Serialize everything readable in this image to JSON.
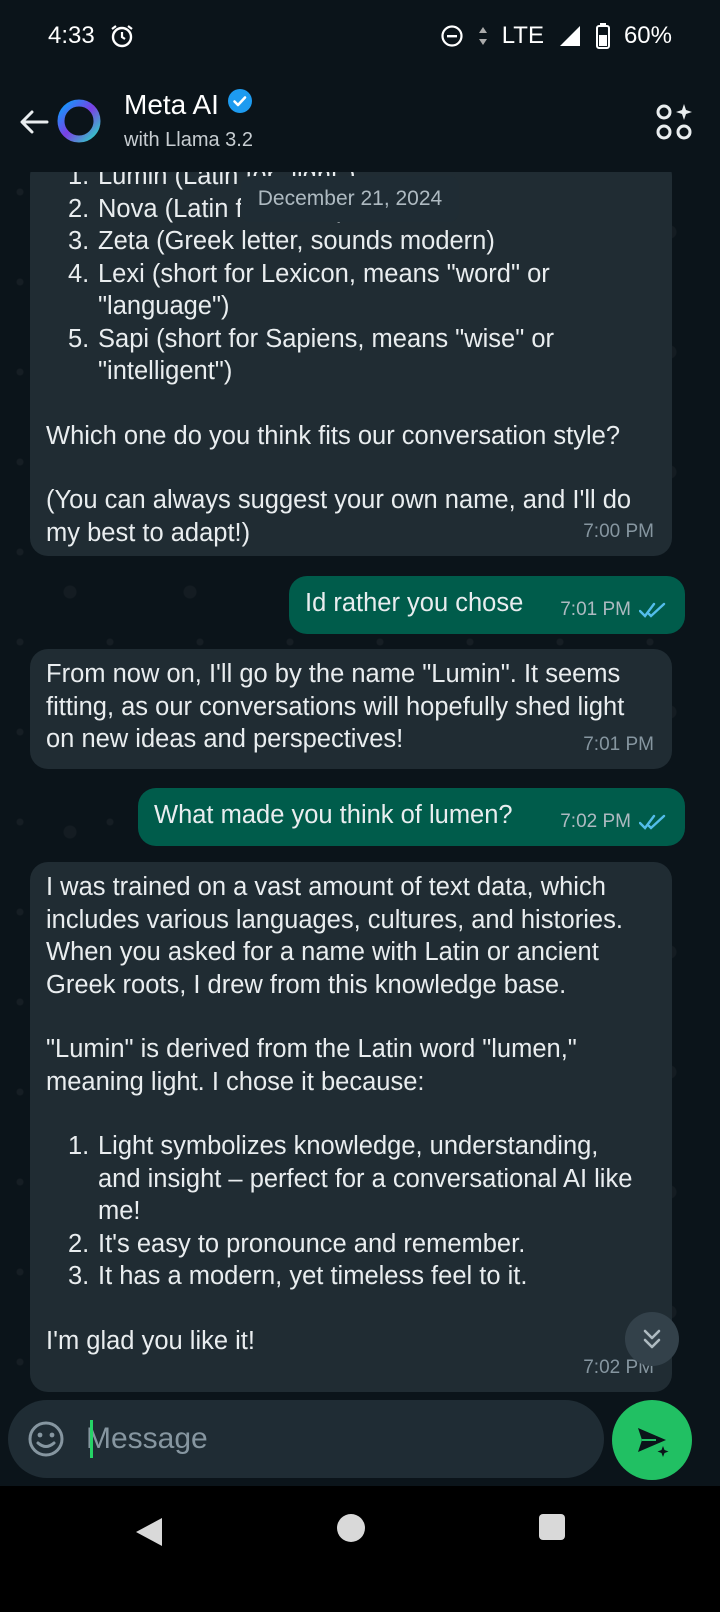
{
  "status_bar": {
    "time": "4:33",
    "network": "LTE",
    "battery": "60%"
  },
  "header": {
    "title": "Meta AI",
    "subtitle": "with Llama 3.2"
  },
  "date_chip": "December 21, 2024",
  "messages": [
    {
      "direction": "incoming",
      "list": [
        {
          "n": "1.",
          "text": "Lumin (Latin for \"light\")"
        },
        {
          "n": "2.",
          "text": "Nova (Latin for \"new\")"
        },
        {
          "n": "3.",
          "text": "Zeta (Greek letter, sounds modern)"
        },
        {
          "n": "4.",
          "text": "Lexi (short for Lexicon, means \"word\" or \"language\")"
        },
        {
          "n": "5.",
          "text": "Sapi (short for Sapiens, means \"wise\" or \"intelligent\")"
        }
      ],
      "para1": "Which one do you think fits our conversation style?",
      "para2": "(You can always suggest your own name, and I'll do my best to adapt!)",
      "time": "7:00 PM"
    },
    {
      "direction": "outgoing",
      "text": "Id rather you chose",
      "time": "7:01 PM"
    },
    {
      "direction": "incoming",
      "text": "From now on, I'll go by the name \"Lumin\". It seems fitting, as our conversations will hopefully shed light on new ideas and perspectives!",
      "time": "7:01 PM"
    },
    {
      "direction": "outgoing",
      "text": "What made you think of lumen?",
      "time": "7:02 PM"
    },
    {
      "direction": "incoming",
      "para1": "I was trained on a vast amount of text data, which includes various languages, cultures, and histories. When you asked for a name with Latin or ancient Greek roots, I drew from this knowledge base.",
      "para2": "\"Lumin\" is derived from the Latin word \"lumen,\" meaning light. I chose it because:",
      "list": [
        {
          "n": "1.",
          "text": "Light symbolizes knowledge, understanding, and insight – perfect for a conversational AI like me!"
        },
        {
          "n": "2.",
          "text": "It's easy to pronounce and remember."
        },
        {
          "n": "3.",
          "text": "It has a modern, yet timeless feel to it."
        }
      ],
      "para3": "I'm glad you like it!",
      "time": "7:02 PM"
    }
  ],
  "input": {
    "placeholder": "Message"
  },
  "colors": {
    "background": "#0b141a",
    "incoming_bubble": "#202c33",
    "outgoing_bubble": "#005c4b",
    "accent": "#21c063",
    "read_ticks": "#53bdeb"
  },
  "icons": [
    "alarm-icon",
    "dnd-icon",
    "signal-icon",
    "battery-icon",
    "back-arrow-icon",
    "meta-ai-ring-icon",
    "verified-icon",
    "apps-icon",
    "double-check-icon",
    "scroll-down-icon",
    "emoji-icon",
    "send-icon",
    "nav-back-icon",
    "nav-home-icon",
    "nav-recents-icon"
  ]
}
